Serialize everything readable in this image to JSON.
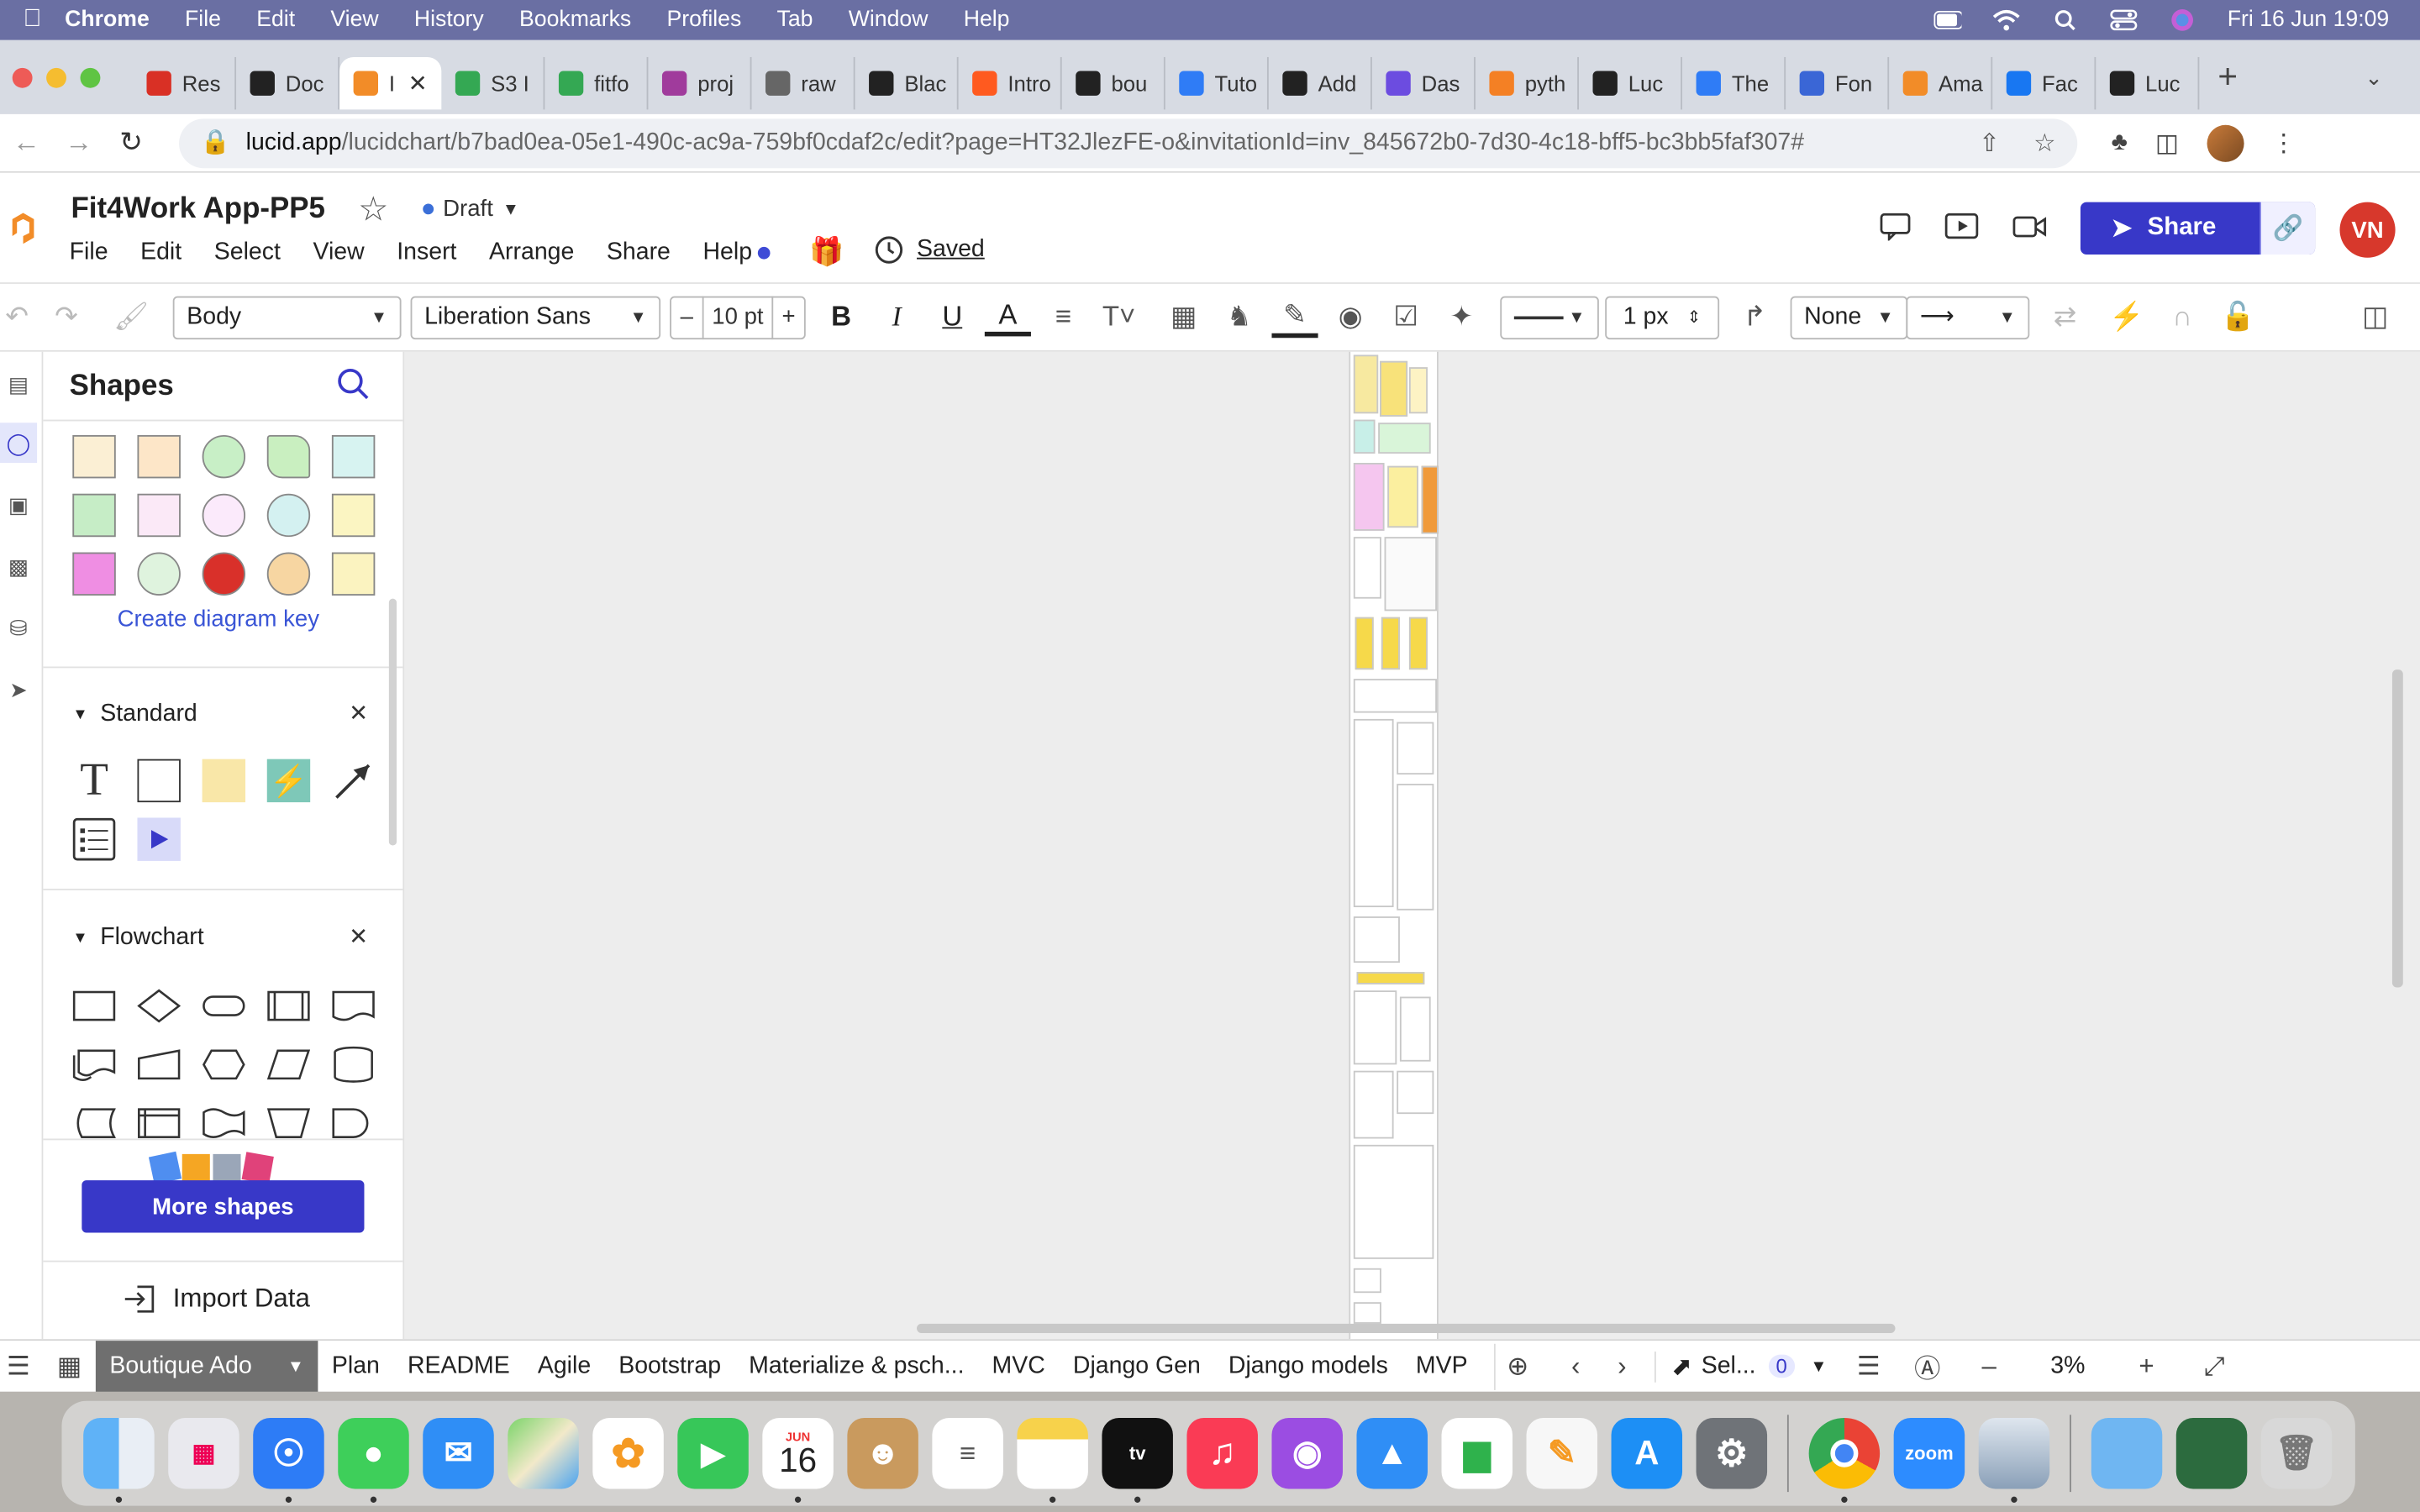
{
  "menubar": {
    "app": "Chrome",
    "items": [
      "File",
      "Edit",
      "View",
      "History",
      "Bookmarks",
      "Profiles",
      "Tab",
      "Window",
      "Help"
    ],
    "datetime": "Fri 16 Jun  19:09"
  },
  "tabs": [
    {
      "label": "Res",
      "icon": "gmail-icon",
      "color": "#d93025"
    },
    {
      "label": "Doc",
      "icon": "lucid-icon",
      "color": "#222222"
    },
    {
      "label": "I",
      "icon": "lucid-orange-icon",
      "color": "#f28c28",
      "active": true
    },
    {
      "label": "S3 I",
      "icon": "sheet-icon",
      "color": "#34a853"
    },
    {
      "label": "fitfo",
      "icon": "sheet-icon",
      "color": "#34a853"
    },
    {
      "label": "proj",
      "icon": "slack-icon",
      "color": "#a03b9c"
    },
    {
      "label": "raw",
      "icon": "globe-icon",
      "color": "#666666"
    },
    {
      "label": "Blac",
      "icon": "terminal-icon",
      "color": "#222222"
    },
    {
      "label": "Intro",
      "icon": "circle-icon",
      "color": "#ff5a1f"
    },
    {
      "label": "bou",
      "icon": "github-icon",
      "color": "#222222"
    },
    {
      "label": "Tuto",
      "icon": "f-icon",
      "color": "#2f7cf6"
    },
    {
      "label": "Add",
      "icon": "github-icon",
      "color": "#222222"
    },
    {
      "label": "Das",
      "icon": "s-icon",
      "color": "#6c4ce0"
    },
    {
      "label": "pyth",
      "icon": "stack-icon",
      "color": "#f48024"
    },
    {
      "label": "Luc",
      "icon": "lucid-icon",
      "color": "#222222"
    },
    {
      "label": "The",
      "icon": "f-icon",
      "color": "#2f7cf6"
    },
    {
      "label": "Fon",
      "icon": "flag-icon",
      "color": "#3a66d6"
    },
    {
      "label": "Ama",
      "icon": "box-icon",
      "color": "#f28c28"
    },
    {
      "label": "Fac",
      "icon": "facebook-icon",
      "color": "#1877f2"
    },
    {
      "label": "Luc",
      "icon": "lucid-icon",
      "color": "#222222"
    }
  ],
  "address": {
    "host": "lucid.app",
    "path": "/lucidchart/b7bad0ea-05e1-490c-ac9a-759bf0cdaf2c/edit?page=HT32JlezFE-o&invitationId=inv_845672b0-7d30-4c18-bff5-bc3bb5faf307#"
  },
  "doc": {
    "title": "Fit4Work App-PP5",
    "status": "Draft",
    "saved": "Saved",
    "menu": [
      "File",
      "Edit",
      "Select",
      "View",
      "Insert",
      "Arrange",
      "Share",
      "Help"
    ],
    "share_label": "Share",
    "user_initials": "VN"
  },
  "toolbar": {
    "style": "Body",
    "font": "Liberation Sans",
    "font_size": "10 pt",
    "line_width": "1 px",
    "arrow_start": "None"
  },
  "shapes_panel": {
    "title": "Shapes",
    "diagram_key_colors": [
      "#fbefd4",
      "#fde6c8",
      "#c8efc6",
      "#c9efc0",
      "#d7f3f1",
      "#c6edc6",
      "#fbe9f7",
      "#fbeafb",
      "#d4f1f1",
      "#fbf5c2",
      "#ef8ee3",
      "#dff3de",
      "#d9302a",
      "#f7d6a2",
      "#fbf3c0"
    ],
    "create_key": "Create diagram key",
    "standard": "Standard",
    "flowchart": "Flowchart",
    "more_shapes": "More shapes",
    "import_data": "Import Data"
  },
  "pages": {
    "active": "Boutique Ado",
    "others": [
      "Plan",
      "README",
      "Agile",
      "Bootstrap",
      "Materialize & psch...",
      "MVC",
      "Django Gen",
      "Django models",
      "MVP"
    ],
    "select_label": "Sel...",
    "selected_count": "0",
    "zoom": "3%"
  },
  "dock": {
    "calendar_month": "JUN",
    "calendar_day": "16",
    "zoom_label": "zoom"
  }
}
